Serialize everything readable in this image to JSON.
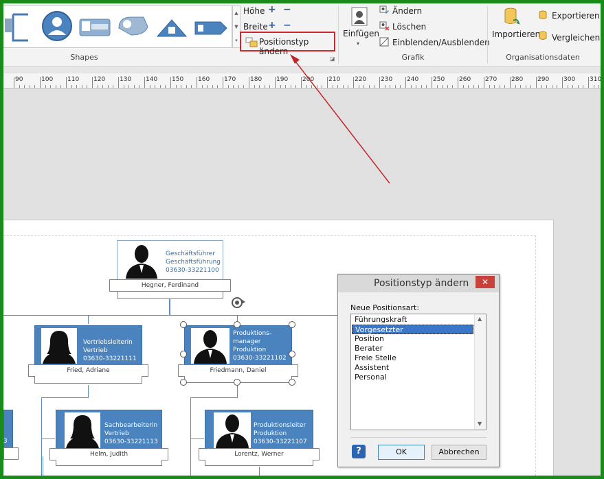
{
  "ribbon": {
    "groups": {
      "shapes": "Shapes",
      "grafik": "Grafik",
      "orgdata": "Organisationsdaten"
    },
    "hoehe_label": "Höhe",
    "breite_label": "Breite",
    "position_type_label": "Positionstyp ändern",
    "einfuegen_label": "Einfügen",
    "aendern_label": "Ändern",
    "loeschen_label": "Löschen",
    "einblenden_label": "Einblenden/Ausblenden",
    "importieren_label": "Importieren",
    "exportieren_label": "Exportieren",
    "vergleichen_label": "Vergleichen",
    "accent_color": "#2b5797",
    "highlight_color": "#d0262a"
  },
  "ruler": {
    "ticks": [
      "90",
      "100",
      "110",
      "120",
      "130",
      "140",
      "150",
      "160",
      "170",
      "180",
      "190",
      "200",
      "210",
      "220",
      "230",
      "240",
      "250",
      "260",
      "270",
      "280",
      "290",
      "300",
      "310"
    ]
  },
  "orgchart": {
    "ceo": {
      "title": "Geschäftsführer",
      "dept": "Geschäftsführung",
      "phone": "03630-33221100",
      "name": "Hegner, Ferdinand"
    },
    "sales_head": {
      "title": "Vertriebsleiterin",
      "dept": "Vertrieb",
      "phone": "03630-33221111",
      "name": "Fried, Adriane"
    },
    "prod_manager": {
      "title1": "Produktions-",
      "title2": "manager",
      "dept": "Produktion",
      "phone": "03630-33221102",
      "name": "Friedmann, Daniel"
    },
    "clerk": {
      "title": "Sachbearbeiterin",
      "dept": "Vertrieb",
      "phone": "03630-33221113",
      "name": "Helm, Judith"
    },
    "prod_lead": {
      "title": "Produktionsleiter",
      "dept": "Produktion",
      "phone": "03630-33221107",
      "name": "Lorentz, Werner"
    },
    "left_partial_phone": "3"
  },
  "dialog": {
    "title": "Positionstyp ändern",
    "close": "✕",
    "list_label": "Neue Positionsart:",
    "items": [
      "Führungskraft",
      "Vorgesetzter",
      "Position",
      "Berater",
      "Freie Stelle",
      "Assistent",
      "Personal"
    ],
    "selected": "Vorgesetzter",
    "help": "?",
    "ok": "OK",
    "cancel": "Abbrechen"
  }
}
